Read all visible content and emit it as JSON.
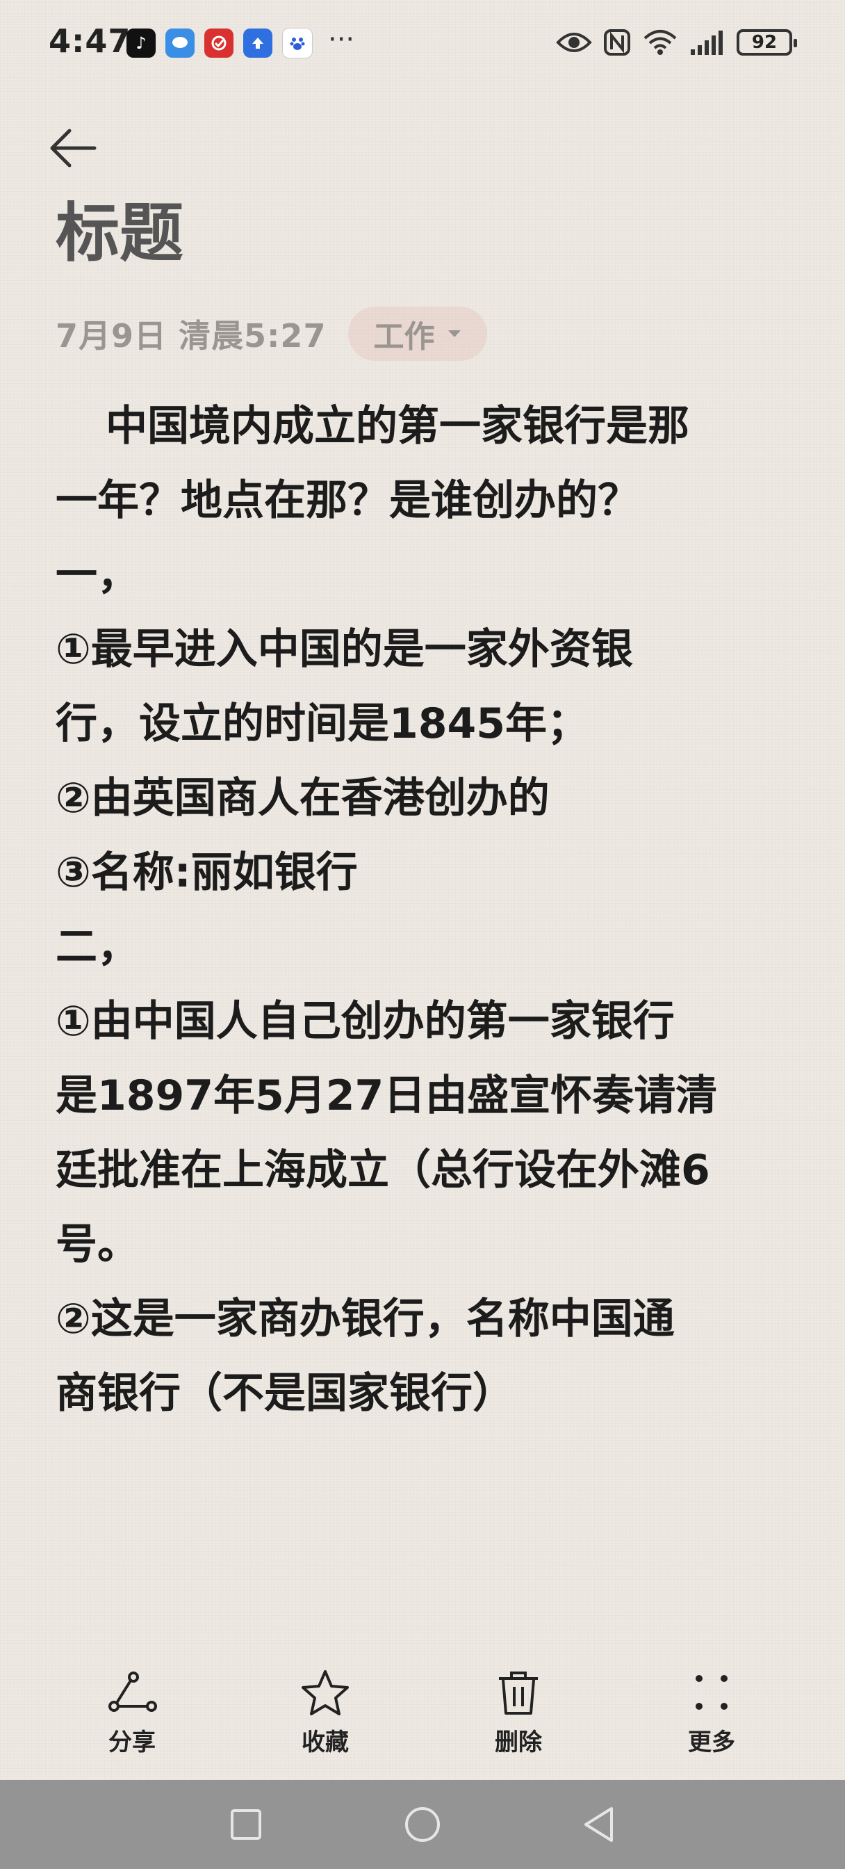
{
  "status_bar": {
    "time": "4:47",
    "battery": "92",
    "app_icons": [
      "tiktok-icon",
      "messages-icon",
      "red-app-icon",
      "blue-upload-app-icon",
      "baidu-icon"
    ],
    "overflow": "···"
  },
  "header": {
    "title": "标题",
    "date": "7月9日 清晨5:27",
    "tag": "工作"
  },
  "note": {
    "lines": [
      "中国境内成立的第一家银行是那",
      "一年？地点在那？是谁创办的？",
      "一，",
      "①最早进入中国的是一家外资银",
      "行，设立的时间是1845年；",
      "②由英国商人在香港创办的",
      "③名称:丽如银行",
      "二，",
      "①由中国人自己创办的第一家银行",
      "是1897年5月27日由盛宣怀奏请清",
      "廷批准在上海成立（总行设在外滩6",
      "号。",
      "②这是一家商办银行，名称中国通",
      "商银行（不是国家银行）"
    ]
  },
  "toolbar": {
    "share": "分享",
    "favorite": "收藏",
    "delete": "删除",
    "more": "更多"
  },
  "colors": {
    "background": "#ede8e2",
    "text": "#1c1c1c",
    "muted": "#9a9590",
    "tag_bg": "#efd9d2",
    "navbar": "#949494"
  }
}
